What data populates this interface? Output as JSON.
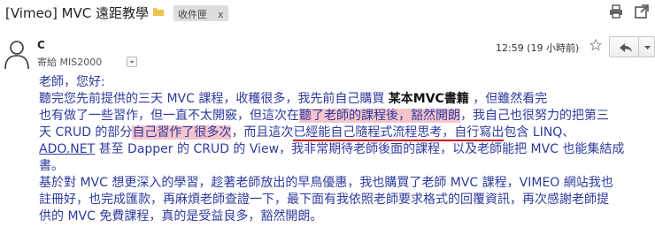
{
  "subject": "[Vimeo] MVC 遠距教學",
  "label": {
    "text": "收件匣",
    "remove": "x"
  },
  "sender": {
    "name": "C",
    "recipient_line": "寄給 MIS2000"
  },
  "timestamp": "12:59 (19 小時前)",
  "icons": {
    "folder": "folder-tag-icon",
    "print": "print-icon",
    "new_window": "open-in-new-window-icon",
    "avatar": "person-avatar-icon",
    "dropdown": "chevron-down-icon",
    "star": "star-icon",
    "reply": "reply-arrow-icon",
    "more": "chevron-down-icon"
  },
  "colors": {
    "body_text": "#2e3a9e",
    "highlight": "#f6c4cc",
    "underline": "#d0101a",
    "label_bg": "#dddddd"
  },
  "body": {
    "greeting": "老師，您好:",
    "l2a": "聽完您先前提供的三天 MVC 課程，收穫很多，我先前自己購買 ",
    "l2b": "某本MVC書籍",
    "l2c": " ，但雖然看完",
    "l3a": "也有做了一些習作，但一直不太開竅，但這次在",
    "l3b": "聽了老師的課程後，豁然開朗",
    "l3c": "，我自己也很努力的把第三",
    "l4a": "天 CRUD 的部分",
    "l4b": "自己習作了很多次",
    "l4c": "，而且這次",
    "l4d": "已經能自己隨程式流程思考，自行寫出",
    "l4e": "包含 LINQ、",
    "l5a": "ADO.NET",
    "l5b": " 甚至 Dapper 的 CRUD 的 View，我非常期待老師後面的課程，以及老師能把 MVC 也能集結成",
    "l6": "書。",
    "l7": "基於對 MVC 想更深入的學習，趁著老師放出的早鳥優惠，我也購買了老師 MVC 課程，VIMEO 網站我也",
    "l8": "註冊好，也完成匯款，再麻煩老師查證一下，最下面有我依照老師要求格式的回覆資訊，再次感謝老師提",
    "l9": "供的 MVC 免費課程，真的是受益良多，豁然開朗。"
  }
}
